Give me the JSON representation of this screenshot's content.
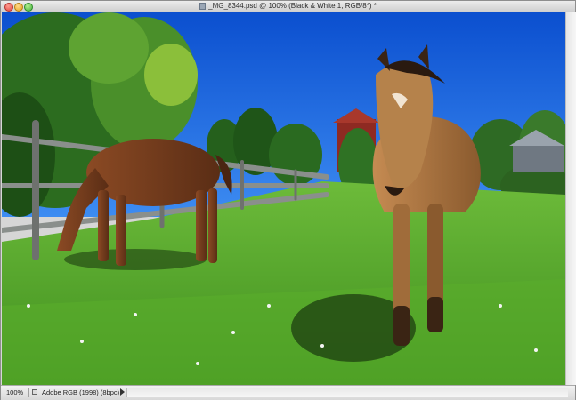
{
  "window": {
    "title": "_MG_8344.psd @ 100% (Black & White 1, RGB/8*) *",
    "doc_icon": "psd-file-icon"
  },
  "canvas": {
    "image_icon": "photo-image",
    "subject": "horses-in-pasture"
  },
  "statusbar": {
    "zoom": "100%",
    "profile": "Adobe RGB (1998) (8bpc)"
  },
  "colors": {
    "sky": "#1565d8",
    "grass": "#4fa12a",
    "fence": "#8a8f8c",
    "horse_left": "#6b3a1e",
    "horse_right": "#b07a43"
  }
}
